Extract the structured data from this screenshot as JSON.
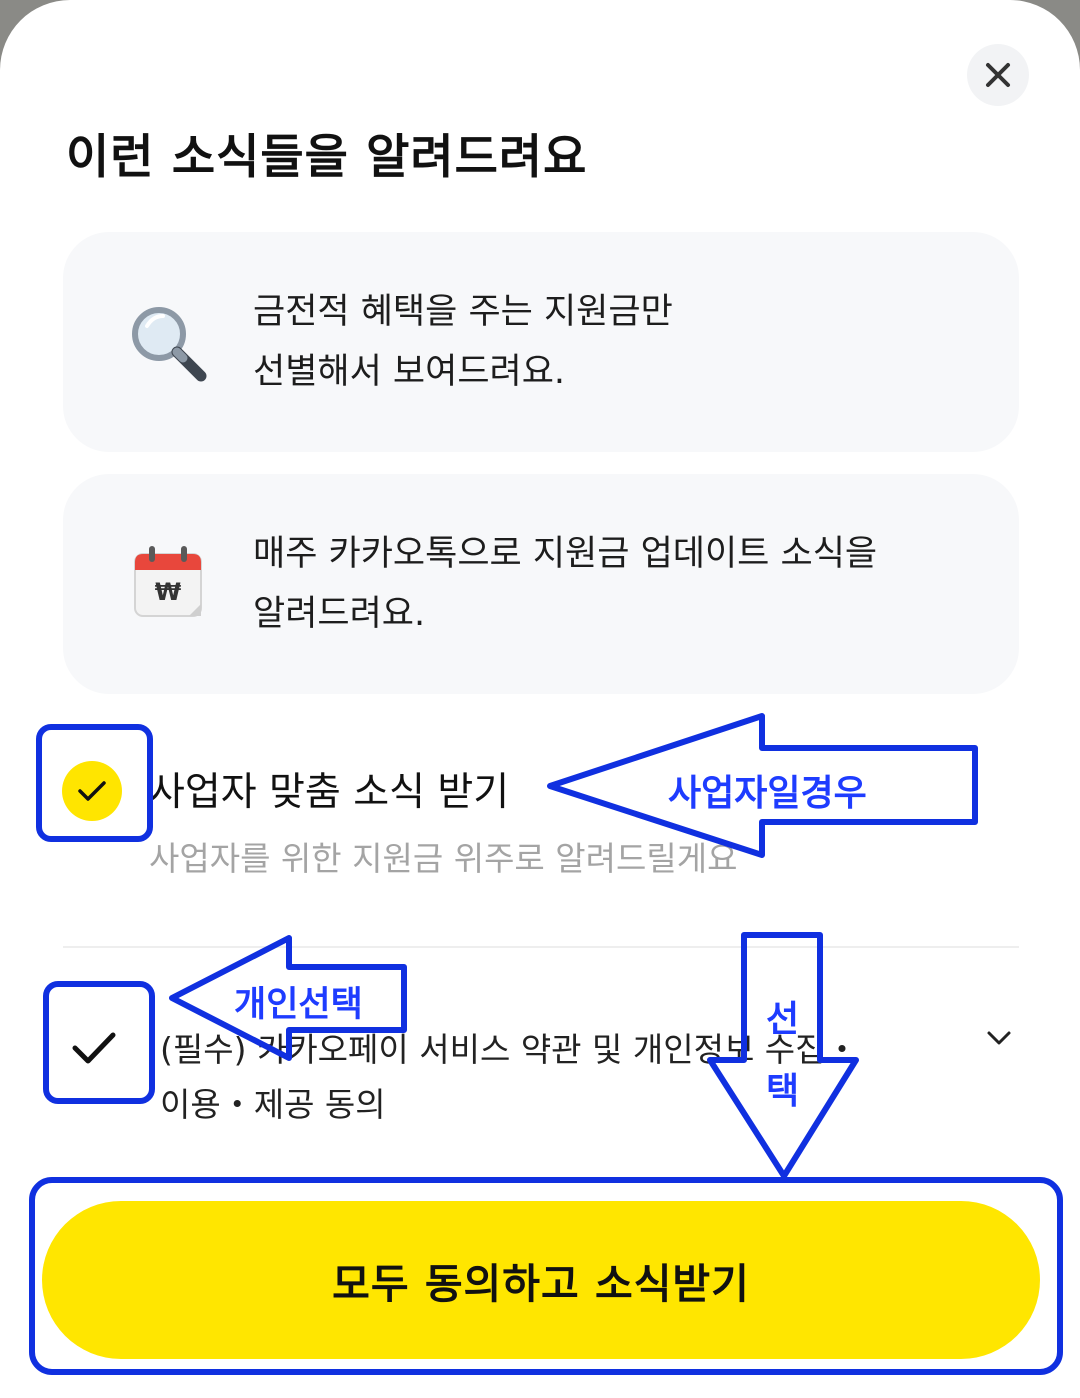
{
  "header": {
    "title": "이런 소식들을 알려드려요",
    "close_icon": "close-icon"
  },
  "cards": [
    {
      "icon": "magnifier-icon",
      "lines": [
        "금전적 혜택을 주는 지원금만",
        "선별해서 보여드려요."
      ]
    },
    {
      "icon": "won-calendar-icon",
      "lines": [
        "매주 카카오톡으로 지원금 업데이트 소식을",
        "알려드려요."
      ]
    }
  ],
  "business_option": {
    "label": "사업자 맞춤 소식 받기",
    "sub": "사업자를 위한 지원금 위주로 알려드릴게요",
    "checked": true
  },
  "terms": {
    "lines": [
      "(필수) 카카오페이 서비스 약관 및 개인정보 수집・",
      "이용・제공 동의"
    ],
    "checked": true
  },
  "cta": {
    "label": "모두 동의하고 소식받기"
  },
  "annotations": {
    "business": "사업자일경우",
    "personal": "개인선택",
    "select": [
      "선",
      "택"
    ],
    "color": "#1e3cff"
  },
  "colors": {
    "accent_yellow": "#ffe500",
    "card_bg": "#f7f8fa"
  }
}
